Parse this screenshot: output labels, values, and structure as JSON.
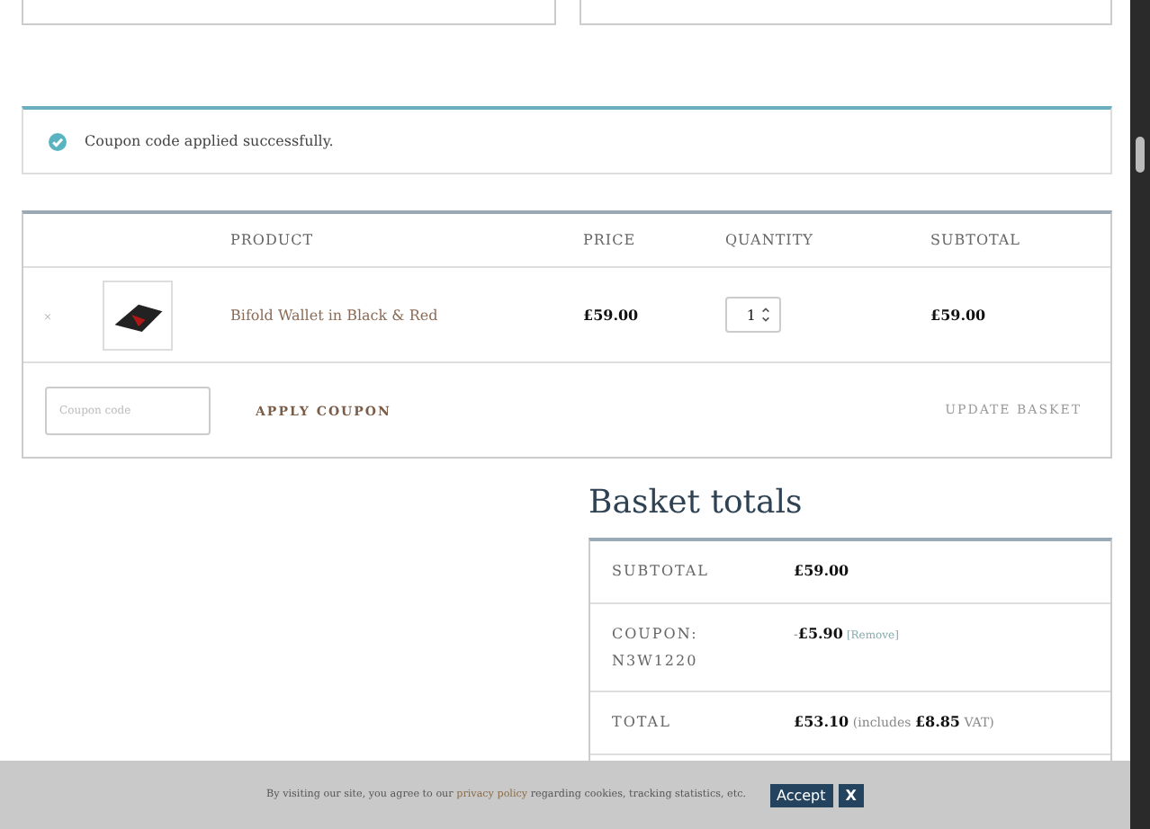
{
  "notice": {
    "message": "Coupon code applied successfully."
  },
  "cart": {
    "columns": [
      "PRODUCT",
      "PRICE",
      "QUANTITY",
      "SUBTOTAL"
    ],
    "rows": [
      {
        "remove": "×",
        "product": "Bifold Wallet in Black & Red",
        "price": "£59.00",
        "quantity": "1",
        "subtotal": "£59.00"
      }
    ],
    "coupon": {
      "placeholder": "Coupon code"
    },
    "apply_button": "APPLY COUPON",
    "update_button": "UPDATE BASKET"
  },
  "totals": {
    "title": "Basket totals",
    "rows": [
      {
        "label": "SUBTOTAL",
        "value": "**£59.00**"
      },
      {
        "label": "COUPON: N3W1220",
        "value": "-**£5.90**",
        "link": "[Remove]"
      },
      {
        "label": "TOTAL",
        "value": "**£53.10** (includes **£8.85** VAT)"
      }
    ]
  },
  "cookie_bar": {
    "before": "By visiting our site, you agree to our ",
    "link": "privacy policy",
    "after": " regarding cookies, tracking statistics, etc.",
    "accept": "Accept",
    "close": "X"
  }
}
